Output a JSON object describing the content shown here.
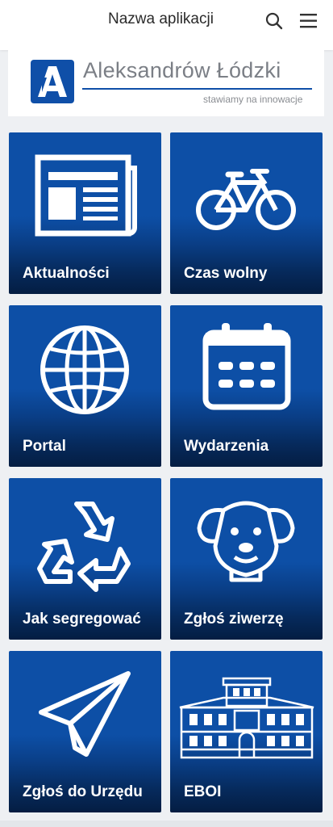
{
  "header": {
    "app_title": "Nazwa aplikacji",
    "search_icon": "search-icon",
    "menu_icon": "hamburger-menu-icon"
  },
  "banner": {
    "brand_name": "Aleksandrów Łódzki",
    "tagline": "stawiamy na innowacje",
    "accent_color": "#0f4fa8"
  },
  "tiles": [
    {
      "label": "Aktualności",
      "icon": "newspaper-icon"
    },
    {
      "label": "Czas wolny",
      "icon": "bicycle-icon"
    },
    {
      "label": "Portal",
      "icon": "globe-icon"
    },
    {
      "label": "Wydarzenia",
      "icon": "calendar-icon"
    },
    {
      "label": "Jak segregować",
      "icon": "recycle-icon"
    },
    {
      "label": "Zgłoś ziwerzę",
      "icon": "dog-icon"
    },
    {
      "label": "Zgłoś do Urzędu",
      "icon": "paper-plane-icon"
    },
    {
      "label": "EBOI",
      "icon": "building-icon"
    }
  ],
  "colors": {
    "tile_top": "#0d4fa6",
    "tile_bottom": "#041d42",
    "background": "#eef0f3"
  }
}
